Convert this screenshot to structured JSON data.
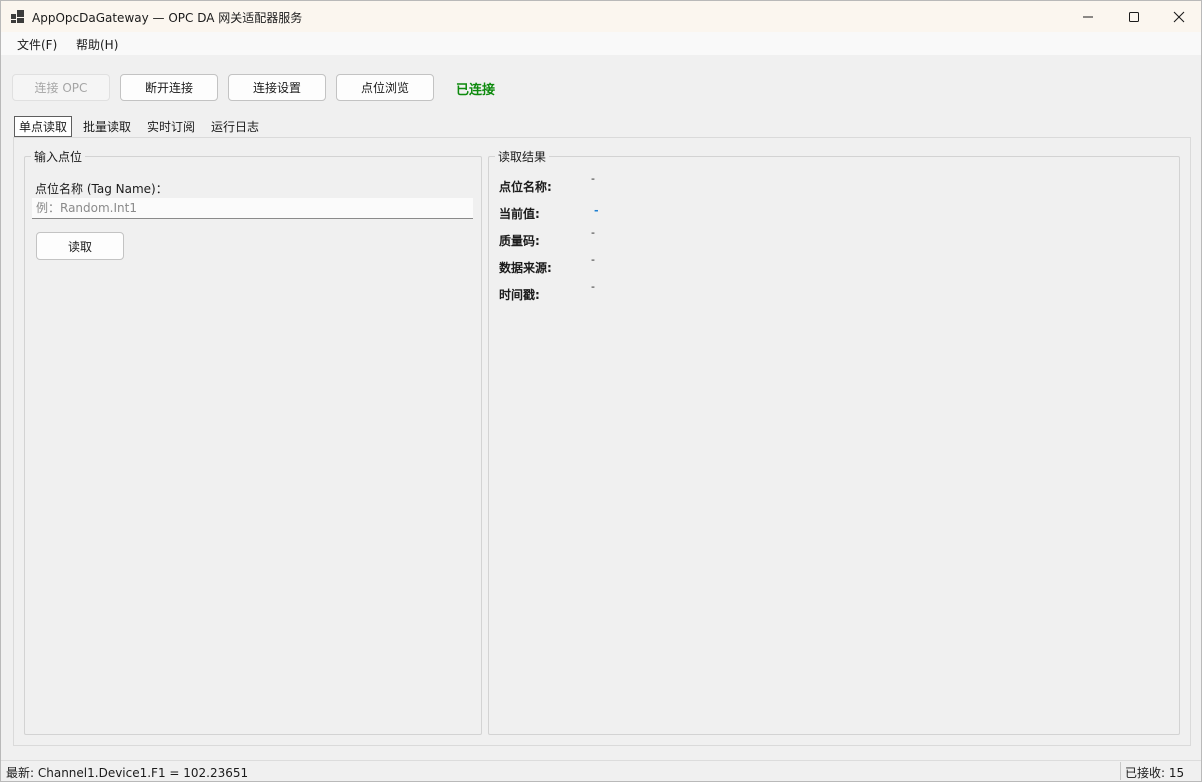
{
  "window": {
    "title": "AppOpcDaGateway — OPC DA 网关适配器服务",
    "app_icon": "app-window-icon",
    "controls": {
      "minimize": "minimize-icon",
      "maximize": "maximize-icon",
      "close": "close-icon"
    }
  },
  "menu": {
    "items": [
      {
        "label": "文件(F)"
      },
      {
        "label": "帮助(H)"
      }
    ]
  },
  "toolbar": {
    "connect_label": "连接 OPC",
    "disconnect_label": "断开连接",
    "settings_label": "连接设置",
    "browse_label": "点位浏览",
    "status": "已连接",
    "status_color": "#0d8a0d"
  },
  "tabs": [
    {
      "label": "单点读取",
      "active": true
    },
    {
      "label": "批量读取",
      "active": false
    },
    {
      "label": "实时订阅",
      "active": false
    },
    {
      "label": "运行日志",
      "active": false
    }
  ],
  "input_group": {
    "title": "输入点位",
    "field_label": "点位名称 (Tag Name)：",
    "placeholder": "例：Random.Int1",
    "value": "",
    "read_label": "读取"
  },
  "result_group": {
    "title": "读取结果",
    "rows": [
      {
        "label": "点位名称:",
        "value": "-"
      },
      {
        "label": "当前值:",
        "value": "-"
      },
      {
        "label": "质量码:",
        "value": "-"
      },
      {
        "label": "数据来源:",
        "value": "-"
      },
      {
        "label": "时间戳:",
        "value": "-"
      }
    ],
    "value_highlight_color": "#1e7fd1"
  },
  "statusbar": {
    "latest": "最新: Channel1.Device1.F1 = 102.23651",
    "received": "已接收: 15"
  }
}
